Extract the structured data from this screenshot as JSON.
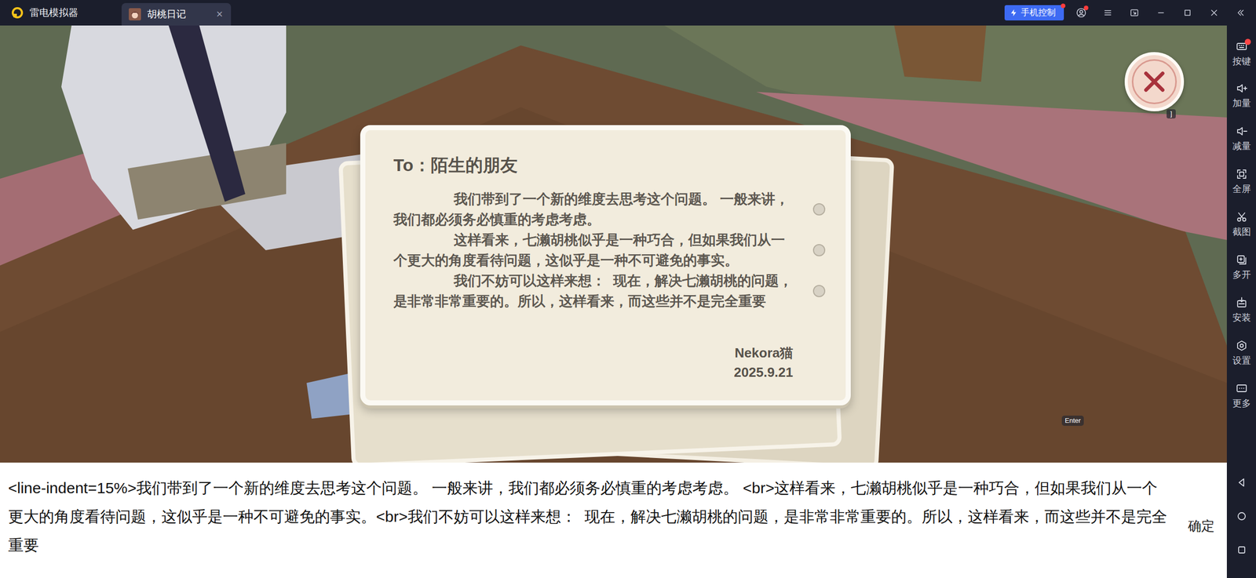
{
  "window": {
    "app_name": "雷电模拟器",
    "tabs": [
      {
        "label": "胡桃日记",
        "close": "×",
        "selected": true
      }
    ],
    "phone_control": {
      "label": "手机控制",
      "notification": true
    },
    "account_notification": true
  },
  "sidebar": {
    "items": [
      {
        "label": "按键",
        "alert": true
      },
      {
        "label": "加量",
        "alert": false
      },
      {
        "label": "减量",
        "alert": false
      },
      {
        "label": "全屏",
        "alert": false
      },
      {
        "label": "截图",
        "alert": false
      },
      {
        "label": "多开",
        "alert": false
      },
      {
        "label": "安装",
        "alert": false
      },
      {
        "label": "设置",
        "alert": false
      },
      {
        "label": "更多",
        "alert": false
      }
    ]
  },
  "game": {
    "close_key_hint": "]",
    "enter_key_hint": "Enter",
    "letter": {
      "to": "To：陌生的朋友",
      "paragraphs": [
        "我们带到了一个新的维度去思考这个问题。 一般来讲，我们都必须务必慎重的考虑考虑。",
        "这样看来，七濑胡桃似乎是一种巧合，但如果我们从一个更大的角度看待问题，这似乎是一种不可避免的事实。",
        "我们不妨可以这样来想：  现在，解决七濑胡桃的问题，是非常非常重要的。所以，这样看来，而这些并不是完全重要"
      ],
      "signature": "Nekora猫",
      "date": "2025.9.21"
    }
  },
  "input_panel": {
    "text": "<line-indent=15%>我们带到了一个新的维度去思考这个问题。 一般来讲，我们都必须务必慎重的考虑考虑。 <br>这样看来，七濑胡桃似乎是一种巧合，但如果我们从一个更大的角度看待问题，这似乎是一种不可避免的事实。<br>我们不妨可以这样来想：  现在，解决七濑胡桃的问题，是非常非常重要的。所以，这样看来，而这些并不是完全重要",
    "button": "确定"
  }
}
